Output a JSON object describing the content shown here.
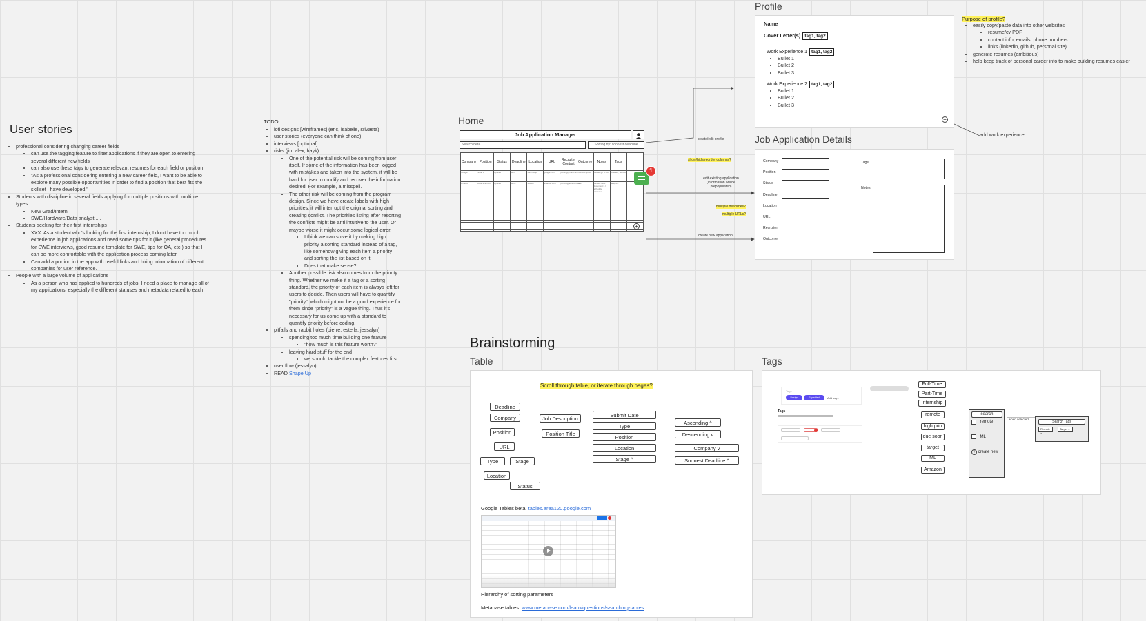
{
  "user_stories": {
    "title": "User stories",
    "items": [
      {
        "text": "professional considering changing career fields",
        "children": [
          {
            "text": "can use the tagging feature to filter applications if they are open to entering several different new fields"
          },
          {
            "text": "can also use these tags to generate relevant resumes for each field or position"
          },
          {
            "text": "\"As a professional considering entering a new career field, I want to be able to explore many possible opportunities in order to find a position that best fits the skillset I have developed.\""
          }
        ]
      },
      {
        "text": "Students with discipline in several fields applying for multiple positions with multiple types",
        "children": [
          {
            "text": "New Grad/Intern"
          },
          {
            "text": "SWE/Hardware/Data analyst....."
          }
        ]
      },
      {
        "text": "Students seeking for their first internships",
        "children": [
          {
            "text": "XXX: As a student who's looking for the first internship, I don't have too much experience in job applications and need some tips for it (like general procedures for SWE interviews, good resume template for SWE, tips for OA, etc.) so that I can be more comfortable with the application process coming later."
          },
          {
            "text": "Can add a portion in the app with useful links and hiring information of different companies for user reference."
          }
        ]
      },
      {
        "text": "People with a large volume of applications",
        "children": [
          {
            "text": "As a person who has applied to hundreds of jobs, I need a place to manage all of my applications, especially the different statuses and metadata related to each"
          }
        ]
      }
    ]
  },
  "todo": {
    "title": "TODO",
    "items": [
      {
        "text": "lofi designs [wireframes] (eric, isabelle, srivasta)"
      },
      {
        "text": "user stories (everyone can think of one)"
      },
      {
        "text": "interviews [optional]"
      },
      {
        "text": "risks (jin, alex, hayk)",
        "children": [
          {
            "text": "One of the potential risk will be coming from user itself. If some of the information has been logged with mistakes and taken into the system, it will be hard for user to modify and recover the information desired. For example, a misspell."
          },
          {
            "text": "The other risk will be coming from the program design. Since we have create labels with high priorities, it will interrupt the original sorting and creating conflict. The priorities listing after resorting the conflicts might be anti intuitive to the user. Or maybe worse it might occur some logical error.",
            "children": [
              {
                "text": "I think we can solve it by making high priority a sorting standard instead of a tag, like somehow giving each item a priority and sorting the list based on it."
              },
              {
                "text": "Does that make sense?"
              }
            ]
          },
          {
            "text": "Another possible risk also comes from the priority thing. Whether we make it a tag or a sorting standard, the priority of each item is always left for users to decide. Then users will have to quantify \"priority\", which might not be a good experience for them since \"priority\" is a vague thing. Thus it's necessary for us come up with a standard to quantify priority before coding."
          }
        ]
      },
      {
        "text": "pitfalls and rabbit holes (pierre, estella, jessalyn)",
        "children": [
          {
            "text": "spending too much time building one feature",
            "children": [
              {
                "text": "\"how much is this feature worth?\""
              }
            ]
          },
          {
            "text": "leaving hard stuff for the end",
            "children": [
              {
                "text": "we should tackle the complex features first"
              }
            ]
          }
        ]
      },
      {
        "text": "user flow (jessalyn)"
      },
      {
        "text": "READ",
        "link": "Shape Up"
      }
    ]
  },
  "home": {
    "title": "Home",
    "app_title": "Job Application Manager",
    "search_placeholder": "Search here...",
    "sort_label": "Sorting by: soonest deadline",
    "columns": [
      "Company",
      "Position",
      "Status",
      "Deadline",
      "Location",
      "URL",
      "Recruiter Contact",
      "Outcome",
      "Notes",
      "Tags"
    ],
    "rows": [
      [
        "Google",
        "SWE II",
        "Applied",
        "11/1",
        "San Diego",
        "google.com",
        "jsmith@gmail.com",
        "Offer Accepted",
        "Please go to 10!",
        "software, remote"
      ],
      [
        "Amazon",
        "Data Scientist",
        "Applied",
        "11/12",
        "Seattle",
        "amazon.com",
        "person@amazon.com",
        "TBD",
        "Review defs / document 6 / schedule interview",
        "data, ML"
      ]
    ],
    "badge_count": "1",
    "notes": {
      "create_edit_profile": "create/edit profile",
      "show_hide": "show/hide/reorder columns?",
      "edit_existing": "edit existing application (information will be prepopulated)",
      "multiple_deadlines": "multiple deadlines?",
      "multiple_urls": "multiple URLs?",
      "create_new": "create new application"
    }
  },
  "profile": {
    "title": "Profile",
    "name_label": "Name",
    "cover_letter_label": "Cover Letter(s)",
    "tags": "tag1, tag2",
    "work1": "Work Experience 1",
    "work2": "Work Experience 2",
    "bullets": [
      "Bullet 1",
      "Bullet 2",
      "Bullet 3"
    ],
    "add_work": "add work experience",
    "purpose_title": "Purpose of profile?",
    "purpose": [
      {
        "text": "easily copy/paste data into other websites",
        "children": [
          {
            "text": "resume/cv PDF"
          },
          {
            "text": "contact info, emails, phone numbers"
          },
          {
            "text": "links (linkedin, github, personal site)"
          }
        ]
      },
      {
        "text": "generate resumes (ambitious)"
      },
      {
        "text": "help keep track of personal career info to make building resumes easier"
      }
    ]
  },
  "details": {
    "title": "Job Application Details",
    "fields": [
      "Company",
      "Position",
      "Status",
      "Deadline",
      "Location",
      "URL",
      "Recruiter",
      "Outcome"
    ],
    "tags_label": "Tags",
    "notes_label": "Notes"
  },
  "brainstorming": {
    "title": "Brainstorming",
    "table_title": "Table",
    "scroll_question": "Scroll through table, or iterate through pages?",
    "buttons_a": [
      "Deadline",
      "Company",
      "Position",
      "URL",
      "Type",
      "Stage",
      "Location",
      "Status"
    ],
    "buttons_b": [
      "Job Description",
      "Position Title"
    ],
    "buttons_c": [
      "Submit Date",
      "Type",
      "Position",
      "Location",
      "Stage ^"
    ],
    "buttons_d": [
      "Ascending ^",
      "Descending v",
      "Company v",
      "Soonest Deadline ^"
    ],
    "google_tables_label": "Google Tables beta:",
    "google_tables_link": "tables.area120.google.com",
    "hierarchy": "Hierarchy of sorting parameters",
    "metabase_label": "Metabase tables:",
    "metabase_link": "www.metabase.com/learn/questions/searching-tables"
  },
  "tags": {
    "title": "Tags",
    "chip_labels": [
      "Design",
      "Expedited"
    ],
    "add_tag": "Add tag...",
    "tags_heading": "Tags",
    "tag_buttons": [
      "Full-Time",
      "Part-Time",
      "Internship",
      "remote",
      "high prio",
      "due soon",
      "target",
      "ML",
      "Amazon"
    ],
    "search_label": "search",
    "check1": "remote",
    "check2": "ML",
    "create_new": "create new",
    "when_selected": "when selected",
    "search_tags": "Search Tags",
    "selected_chips": [
      "Remote",
      "Target"
    ]
  },
  "colors": {
    "highlight": "#fff25a",
    "badge": "#e53935",
    "comment": "#4caf50",
    "link": "#2a6bd8",
    "tag_blue": "#1e88e5",
    "tag_green": "#2ecc71",
    "chip_purple": "#5b4cf0"
  }
}
